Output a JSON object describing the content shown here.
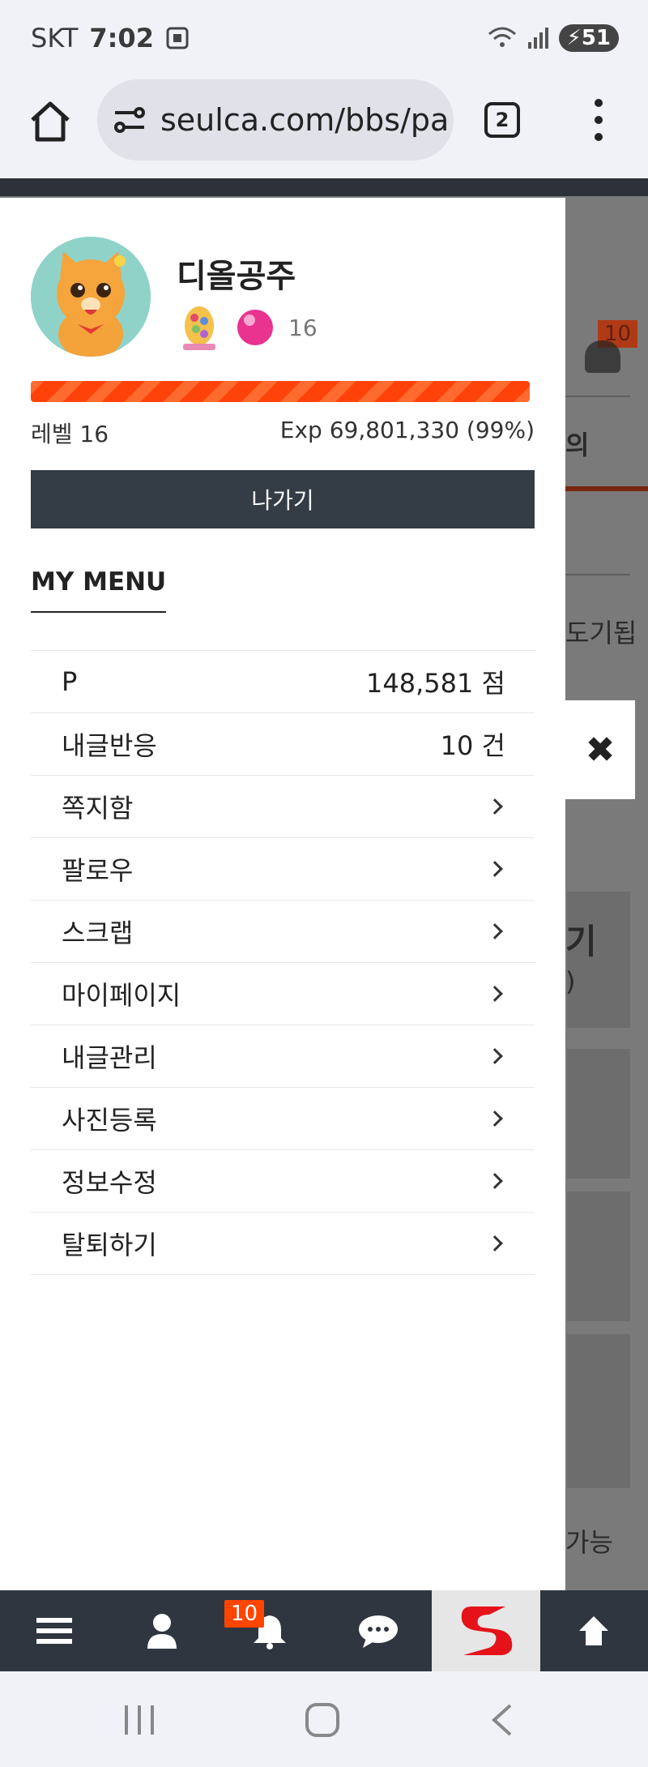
{
  "status_bar": {
    "carrier": "SKT",
    "time": "7:02",
    "battery": "51"
  },
  "browser": {
    "url": "seulca.com/bbs/pa",
    "tab_count": "2"
  },
  "profile": {
    "username": "디올공주",
    "level_badge_number": "16",
    "level_label": "레벨 16",
    "exp_text": "Exp 69,801,330 (99%)",
    "exp_progress": 0.99,
    "logout_label": "나가기"
  },
  "menu": {
    "title": "MY MENU",
    "points": {
      "label": "P",
      "value": "148,581 점"
    },
    "reactions": {
      "label": "내글반응",
      "value": "10 건"
    },
    "items": [
      {
        "label": "쪽지함"
      },
      {
        "label": "팔로우"
      },
      {
        "label": "스크랩"
      },
      {
        "label": "마이페이지"
      },
      {
        "label": "내글관리"
      },
      {
        "label": "사진등록"
      },
      {
        "label": "정보수정"
      },
      {
        "label": "탈퇴하기"
      }
    ]
  },
  "background_page": {
    "notif_count": "10",
    "peek_1": "의",
    "peek_2": "도기됩",
    "peek_3": "기",
    "peek_4": ")",
    "peek_5": "가능"
  },
  "bottom_nav": {
    "notif_count": "10",
    "items": [
      "menu-icon",
      "user-icon",
      "bell-icon",
      "chat-icon",
      "site-logo",
      "arrow-up-icon"
    ]
  },
  "colors": {
    "accent": "#ff4500",
    "dark": "#343c46",
    "exp_bar": "#ff4f12"
  }
}
